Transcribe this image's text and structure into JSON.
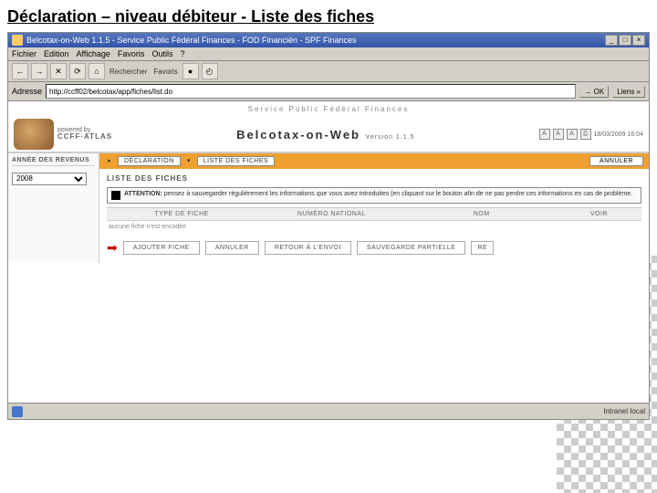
{
  "slide": {
    "title": "Déclaration – niveau débiteur - Liste des fiches"
  },
  "window": {
    "title": "Belcotax-on-Web 1.1.5 - Service Public Fédéral Finances - FOD Financiën - SPF Finances",
    "min": "_",
    "max": "□",
    "close": "×"
  },
  "menu": {
    "file": "Fichier",
    "edit": "Edition",
    "view": "Affichage",
    "fav": "Favoris",
    "tools": "Outils",
    "help": "?"
  },
  "toolbar": {
    "back": "←",
    "fwd": "→",
    "stop": "✕",
    "refresh": "⟳",
    "home": "⌂",
    "search": "Rechercher",
    "fav": "Favoris",
    "media": "●",
    "hist": "◴"
  },
  "address": {
    "label": "Adresse",
    "url": "http://ccff02/belcotax/app/fiches/list.do",
    "go": "→ OK",
    "links": "Liens »"
  },
  "header": {
    "ministry": "Service Public Fédéral Finances",
    "powered": "powered by",
    "ccff": "CCFF·ATLAS",
    "app_title": "Belcotax-on-Web",
    "version": "Version 1.1.5",
    "date": "18/03/2009 16:04",
    "a1": "A",
    "a2": "A",
    "a3": "A"
  },
  "sidebar": {
    "header": "ANNÉE DES REVENUS",
    "year": "2008"
  },
  "breadcrumb": {
    "icon1": "▸",
    "declaration": "DÉCLARATION",
    "icon2": "▾",
    "liste": "LISTE DES FICHES",
    "annuler": "ANNULER"
  },
  "section": {
    "title": "LISTE DES FICHES"
  },
  "warning": {
    "label": "ATTENTION:",
    "text": "pensez à sauvegarder régulièrement les informations que vous avez introduites (en cliquant sur le bouton afin de ne pas perdre ces informations en cas de problème."
  },
  "table": {
    "col1": "TYPE DE FICHE",
    "col2": "NUMÉRO NATIONAL",
    "col3": "NOM",
    "col4": "VOIR",
    "empty": "aucune fiche n'est encodée"
  },
  "actions": {
    "arrow": "➡",
    "ajouter": "AJOUTER FICHE",
    "annuler": "ANNULER",
    "retour": "RETOUR À L'ENVOI",
    "sauvegarde": "SAUVEGARDE PARTIELLE",
    "re": "RE"
  },
  "status": {
    "left": "",
    "right": "Intranet local"
  }
}
